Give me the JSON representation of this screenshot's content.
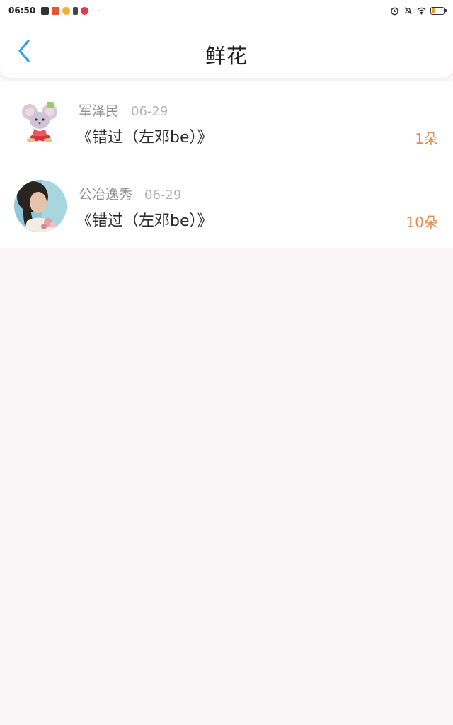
{
  "status_bar": {
    "time": "06:50",
    "more": "···"
  },
  "nav": {
    "title": "鲜花",
    "back_icon": "chevron-left-icon",
    "accent_color": "#2a9df4"
  },
  "items": [
    {
      "user": "军泽民",
      "date": "06-29",
      "work": "《错过（左邓be）》",
      "count": "1朵"
    },
    {
      "user": "公冶逸秀",
      "date": "06-29",
      "work": "《错过（左邓be）》",
      "count": "10朵"
    }
  ],
  "colors": {
    "count": "#e88a4e",
    "background": "#f8f6f6"
  }
}
